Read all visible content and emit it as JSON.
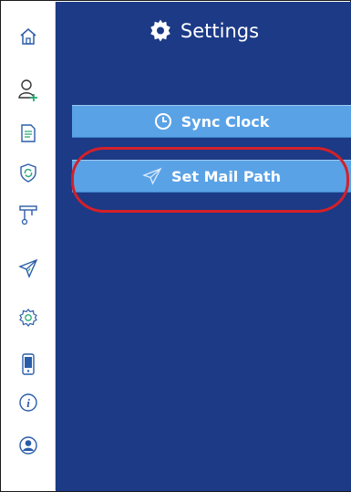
{
  "header": {
    "title": "Settings",
    "icon": "gear-icon"
  },
  "buttons": {
    "sync_clock": {
      "label": "Sync Clock",
      "icon": "clock-icon"
    },
    "set_mail_path": {
      "label": "Set Mail Path",
      "icon": "paper-plane-icon"
    }
  },
  "sidebar": {
    "items": [
      {
        "icon": "home-icon"
      },
      {
        "icon": "add-user-icon"
      },
      {
        "icon": "document-icon"
      },
      {
        "icon": "shield-sync-icon"
      },
      {
        "icon": "device-probe-icon"
      },
      {
        "icon": "paper-plane-icon"
      },
      {
        "icon": "gear-icon"
      },
      {
        "icon": "mobile-phone-icon"
      },
      {
        "icon": "info-icon"
      },
      {
        "icon": "user-avatar-icon"
      }
    ]
  },
  "colors": {
    "main_background": "#1c3a86",
    "button_background": "#5aa2e6",
    "highlight": "#d42029",
    "icon_stroke": "#2a5da8"
  }
}
